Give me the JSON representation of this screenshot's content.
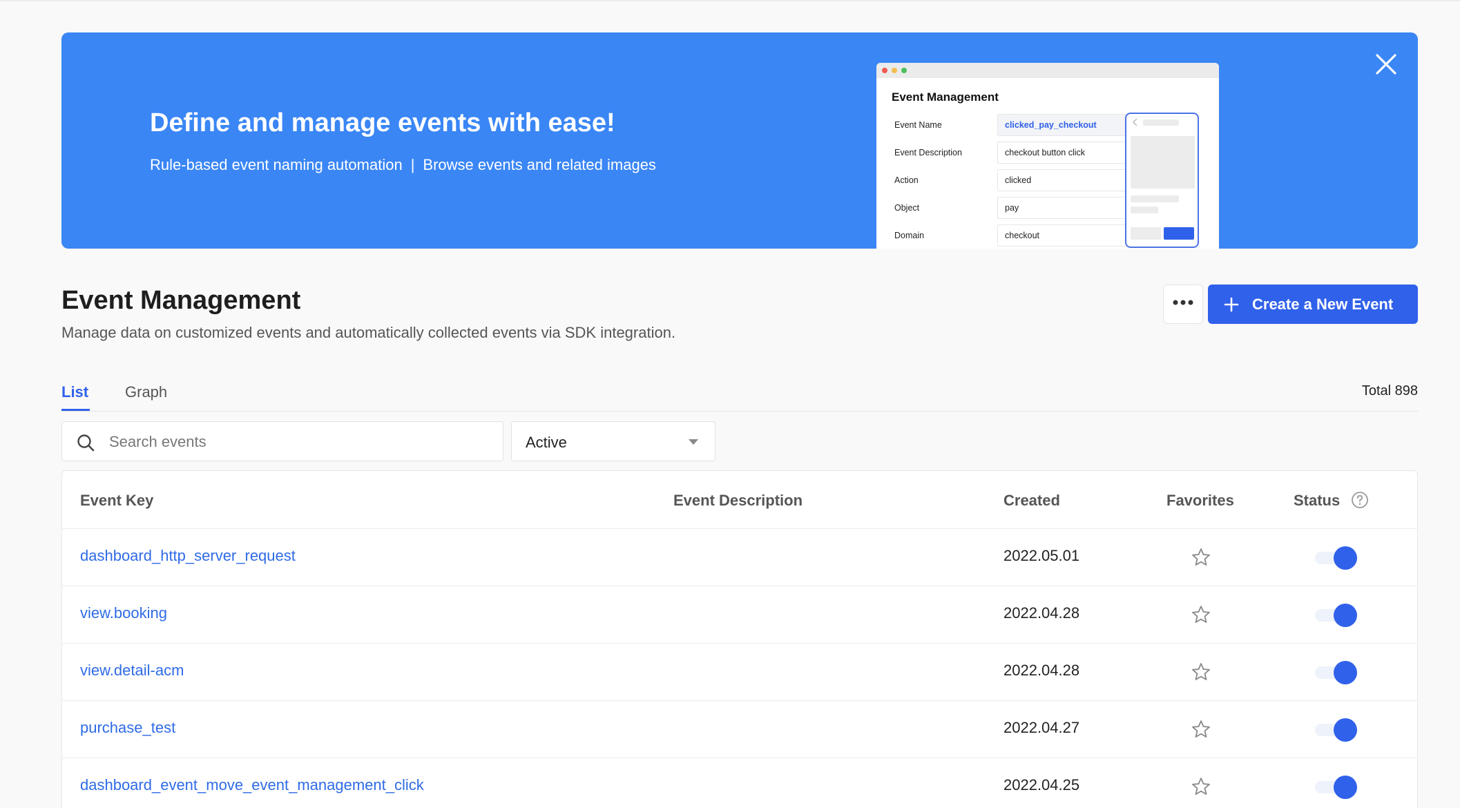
{
  "banner": {
    "title": "Define and manage events with ease!",
    "subtitle_left": "Rule-based event naming automation",
    "subtitle_sep": "|",
    "subtitle_right": "Browse events and related images",
    "preview": {
      "title": "Event Management",
      "fields": [
        {
          "label": "Event Name",
          "value": "clicked_pay_checkout"
        },
        {
          "label": "Event Description",
          "value": "checkout button click"
        },
        {
          "label": "Action",
          "value": "clicked"
        },
        {
          "label": "Object",
          "value": "pay"
        },
        {
          "label": "Domain",
          "value": "checkout"
        }
      ]
    }
  },
  "header": {
    "title": "Event Management",
    "description": "Manage data on customized events and automatically collected events via SDK integration.",
    "create_label": "Create a New Event"
  },
  "tabs": [
    {
      "label": "List",
      "active": true
    },
    {
      "label": "Graph",
      "active": false
    }
  ],
  "total_label": "Total 898",
  "filters": {
    "search_placeholder": "Search events",
    "status_selected": "Active"
  },
  "table": {
    "columns": [
      "Event Key",
      "Event Description",
      "Created",
      "Favorites",
      "Status"
    ],
    "rows": [
      {
        "key": "dashboard_http_server_request",
        "description": "",
        "created": "2022.05.01",
        "favorite": false,
        "status": "on"
      },
      {
        "key": "view.booking",
        "description": "",
        "created": "2022.04.28",
        "favorite": false,
        "status": "on"
      },
      {
        "key": "view.detail-acm",
        "description": "",
        "created": "2022.04.28",
        "favorite": false,
        "status": "on"
      },
      {
        "key": "purchase_test",
        "description": "",
        "created": "2022.04.27",
        "favorite": false,
        "status": "on"
      },
      {
        "key": "dashboard_event_move_event_management_click",
        "description": "",
        "created": "2022.04.25",
        "favorite": false,
        "status": "on"
      }
    ]
  },
  "colors": {
    "banner": "#3a86f5",
    "primary": "#3061ea",
    "link": "#2f6be6"
  },
  "icons": {
    "close": "close-icon",
    "more": "more-horizontal-icon",
    "plus": "plus-icon",
    "search": "search-icon",
    "caret": "caret-down-icon",
    "help": "help-circle-icon",
    "star": "star-outline-icon"
  }
}
